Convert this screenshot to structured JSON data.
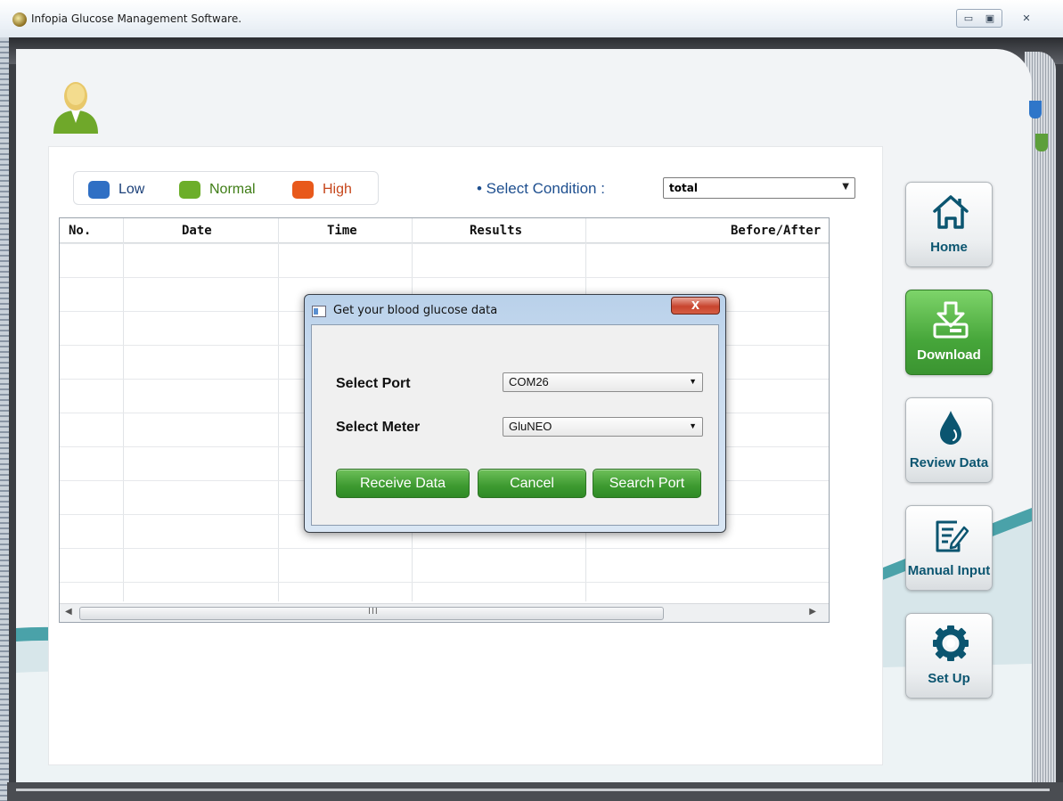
{
  "window": {
    "title": "Infopia Glucose Management Software.",
    "controls": {
      "minimize": "▭",
      "maximize": "▣",
      "close": "✕"
    }
  },
  "legend": {
    "items": [
      {
        "label": "Low",
        "color": "#2f6fc4"
      },
      {
        "label": "Normal",
        "color": "#6cae2a"
      },
      {
        "label": "High",
        "color": "#e8591b"
      }
    ]
  },
  "condition": {
    "label": "• Select Condition :",
    "selected": "total"
  },
  "table": {
    "headers": [
      "No.",
      "Date",
      "Time",
      "Results",
      "Before/After"
    ],
    "rows": [],
    "scroll_grip": "III"
  },
  "dialog": {
    "title": "Get your blood glucose data",
    "close_label": "X",
    "port_label": "Select Port",
    "port_value": "COM26",
    "meter_label": "Select Meter",
    "meter_value": "GluNEO",
    "buttons": {
      "receive": "Receive Data",
      "cancel": "Cancel",
      "search": "Search Port"
    }
  },
  "nav": {
    "items": [
      {
        "label": "Home",
        "icon": "home-icon"
      },
      {
        "label": "Download",
        "icon": "download-icon",
        "active": true
      },
      {
        "label": "Review Data",
        "icon": "drop-icon"
      },
      {
        "label": "Manual Input",
        "icon": "edit-icon"
      },
      {
        "label": "Set Up",
        "icon": "gear-icon"
      }
    ]
  },
  "colors": {
    "accent_teal": "#3a9aa3",
    "accent_green": "#46a63a",
    "condition_text": "#1e4f8f"
  }
}
